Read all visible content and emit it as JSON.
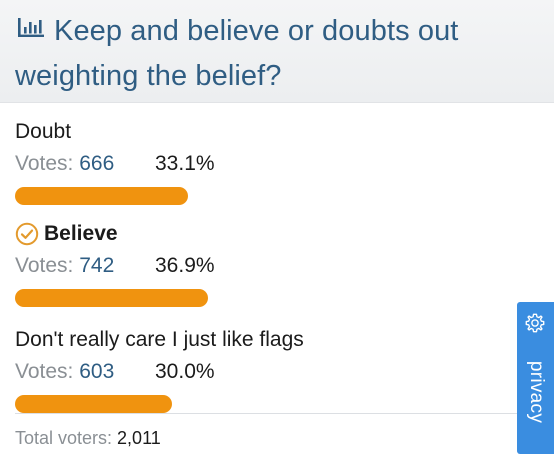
{
  "poll": {
    "title": "Keep and believe or doubts out weighting the belief?",
    "vote_word": "Votes: ",
    "options": [
      {
        "label": "Doubt",
        "votes": "666",
        "percent": "33.1%",
        "share": 33.1,
        "voted": false
      },
      {
        "label": "Believe",
        "votes": "742",
        "percent": "36.9%",
        "share": 36.9,
        "voted": true
      },
      {
        "label": "Don't really care I just like flags",
        "votes": "603",
        "percent": "30.0%",
        "share": 30.0,
        "voted": false
      }
    ],
    "total_label": "Total voters: ",
    "total_value": "2,011"
  },
  "privacy": {
    "label": "privacy"
  },
  "icons": {
    "poll": "bar-chart-icon",
    "voted": "check-circle-icon",
    "privacy": "gear-icon"
  },
  "colors": {
    "accent": "#2f5d83",
    "bar": "#f0930f",
    "privacy_tab": "#3a8de0",
    "check": "#e39a2d"
  }
}
